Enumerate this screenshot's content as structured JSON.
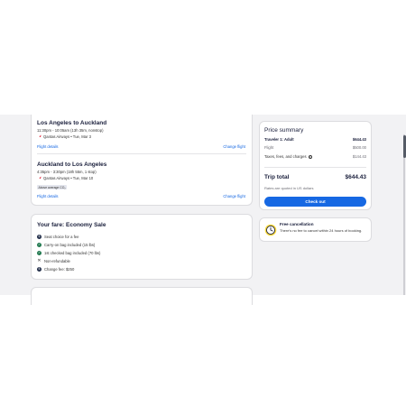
{
  "flights": [
    {
      "title": "Los Angeles to Auckland",
      "time": "11:30pm - 10:05am (13h 35m, nonstop)",
      "airline": "Qantas Airways • Tue, Mar 3",
      "details_link": "Flight details",
      "change_link": "Change flight"
    },
    {
      "title": "Auckland to Los Angeles",
      "time": "4:35pm - 3:30pm (18h 55m, 1 stop)",
      "airline": "Qantas Airways • Tue, Mar 10",
      "badge": "Above average CO₂",
      "details_link": "Flight details",
      "change_link": "Change flight"
    }
  ],
  "fare": {
    "title": "Your fare: Economy Sale",
    "items": [
      {
        "icon": "dollar-icon",
        "text": "Seat choice for a fee"
      },
      {
        "icon": "check-icon",
        "text": "Carry-on bag included (15 lbs)"
      },
      {
        "icon": "check-icon",
        "text": "1st checked bag included (70 lbs)"
      },
      {
        "icon": "close-icon",
        "text": "Non-refundable"
      },
      {
        "icon": "dollar-icon",
        "text": "Change fee: $250"
      }
    ]
  },
  "price_summary": {
    "title": "Price summary",
    "traveler_label": "Traveler 1: Adult",
    "traveler_amount": "$644.43",
    "flight_label": "Flight",
    "flight_amount": "$500.00",
    "taxes_label": "Taxes, fees, and charges",
    "taxes_amount": "$144.43",
    "total_label": "Trip total",
    "total_amount": "$644.43",
    "rates_note": "Rates are quoted in US dollars",
    "checkout_label": "Check out"
  },
  "cancellation": {
    "title": "Free cancellation",
    "text": "There's no fee to cancel within 24 hours of booking."
  },
  "colors": {
    "accent": "#1668e3",
    "heading": "#191e3b",
    "success": "#227950"
  }
}
